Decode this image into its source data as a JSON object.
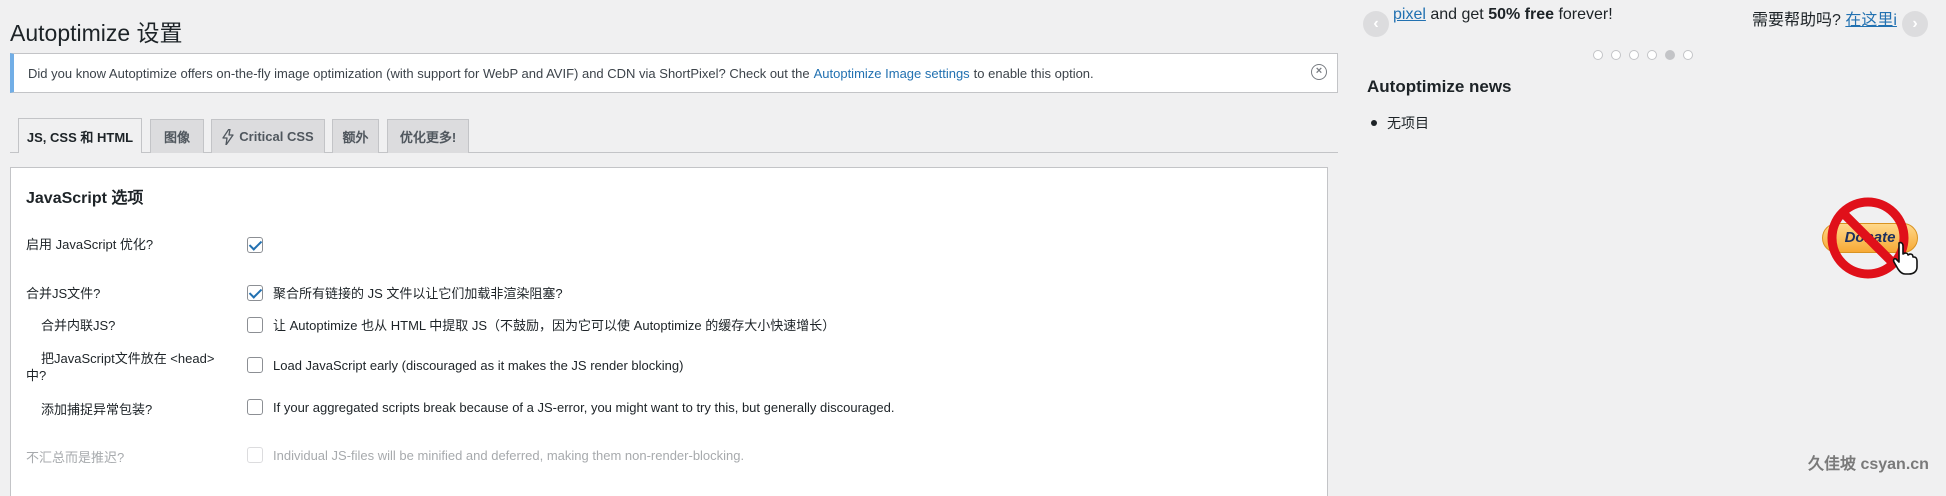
{
  "page": {
    "title": "Autoptimize 设置"
  },
  "notice": {
    "text_before": "Did you know Autoptimize offers on-the-fly image optimization (with support for WebP and AVIF) and CDN via ShortPixel? Check out the",
    "link_text": "Autoptimize Image settings",
    "text_after": "to enable this option."
  },
  "tabs": [
    {
      "label": "JS, CSS 和 HTML",
      "active": true
    },
    {
      "label": "图像",
      "active": false
    },
    {
      "label": "Critical CSS",
      "active": false,
      "icon": "lightning-icon"
    },
    {
      "label": "额外",
      "active": false
    },
    {
      "label": "优化更多!",
      "active": false
    }
  ],
  "js_section": {
    "title": "JavaScript 选项",
    "rows": [
      {
        "label": "启用 JavaScript 优化?",
        "checked": true,
        "description": ""
      },
      {
        "label": "合并JS文件?",
        "checked": true,
        "description": "聚合所有链接的 JS 文件以让它们加载非渲染阻塞?"
      },
      {
        "label": "合并内联JS?",
        "checked": false,
        "description": "让 Autoptimize 也从 HTML 中提取 JS（不鼓励，因为它可以使 Autoptimize 的缓存大小快速增长）"
      },
      {
        "label_line1": "把JavaScript文件放在 <head>",
        "label_line2": "中?",
        "checked": false,
        "description": "Load JavaScript early (discouraged as it makes the JS render blocking)"
      },
      {
        "label": "添加捕捉异常包装?",
        "checked": false,
        "description": "If your aggregated scripts break because of a JS-error, you might want to try this, but generally discouraged."
      },
      {
        "label": "不汇总而是推迟?",
        "checked": false,
        "disabled": true,
        "description": "Individual JS-files will be minified and deferred, making them non-render-blocking."
      }
    ]
  },
  "sidebar": {
    "carousel_link": "pixel",
    "carousel_middle": " and get ",
    "carousel_bold": "50% free",
    "carousel_end": " forever!",
    "help_text": "需要帮助吗? ",
    "help_link": "在这里i",
    "carousel_dots": 6,
    "active_dot": 5,
    "news_title": "Autoptimize news",
    "news_items": [
      "无项目"
    ],
    "donate_label": "Donate"
  },
  "watermark": "久佳坡 csyan.cn",
  "colors": {
    "accent": "#2271b1",
    "notice_border": "#72aee6",
    "no_sign": "#e0101a"
  }
}
